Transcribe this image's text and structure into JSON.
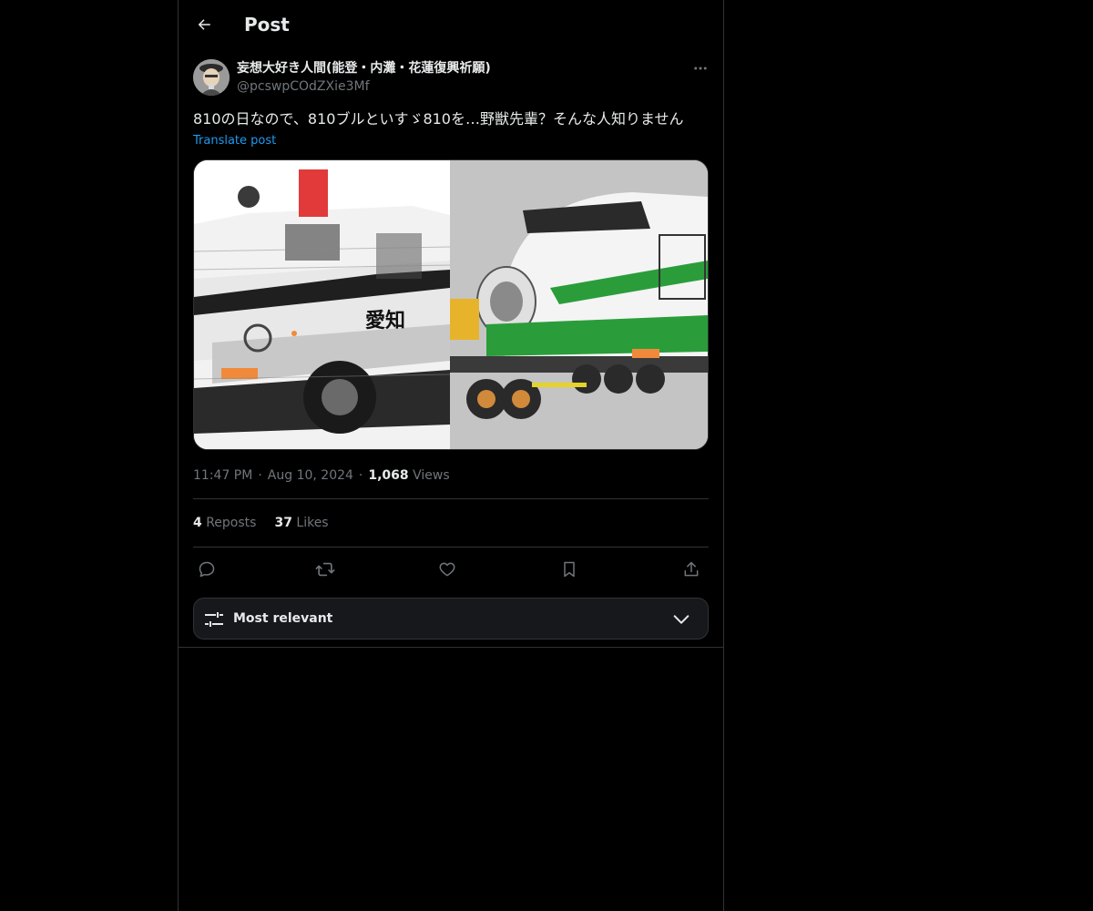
{
  "header": {
    "title": "Post"
  },
  "post": {
    "author": {
      "display_name": "妄想大好き人間(能登・内灘・花蓮復興祈願)",
      "handle": "@pcswpCOdZXie3Mf"
    },
    "text": "810の日なので、810ブルといすゞ810を…野獣先輩？そんな人知りません",
    "translate_label": "Translate post",
    "time": "11:47 PM",
    "date": "Aug 10, 2024",
    "views_count": "1,068",
    "views_label": "Views",
    "reposts_count": "4",
    "reposts_label": "Reposts",
    "likes_count": "37",
    "likes_label": "Likes",
    "media_left_text": "愛知"
  },
  "sort": {
    "label": "Most relevant"
  },
  "colors": {
    "background": "#000000",
    "accent": "#1d9bf0",
    "muted": "#71767b",
    "border": "#2f3336",
    "green_band": "#2a9d3a",
    "red_light": "#e23a3a"
  }
}
